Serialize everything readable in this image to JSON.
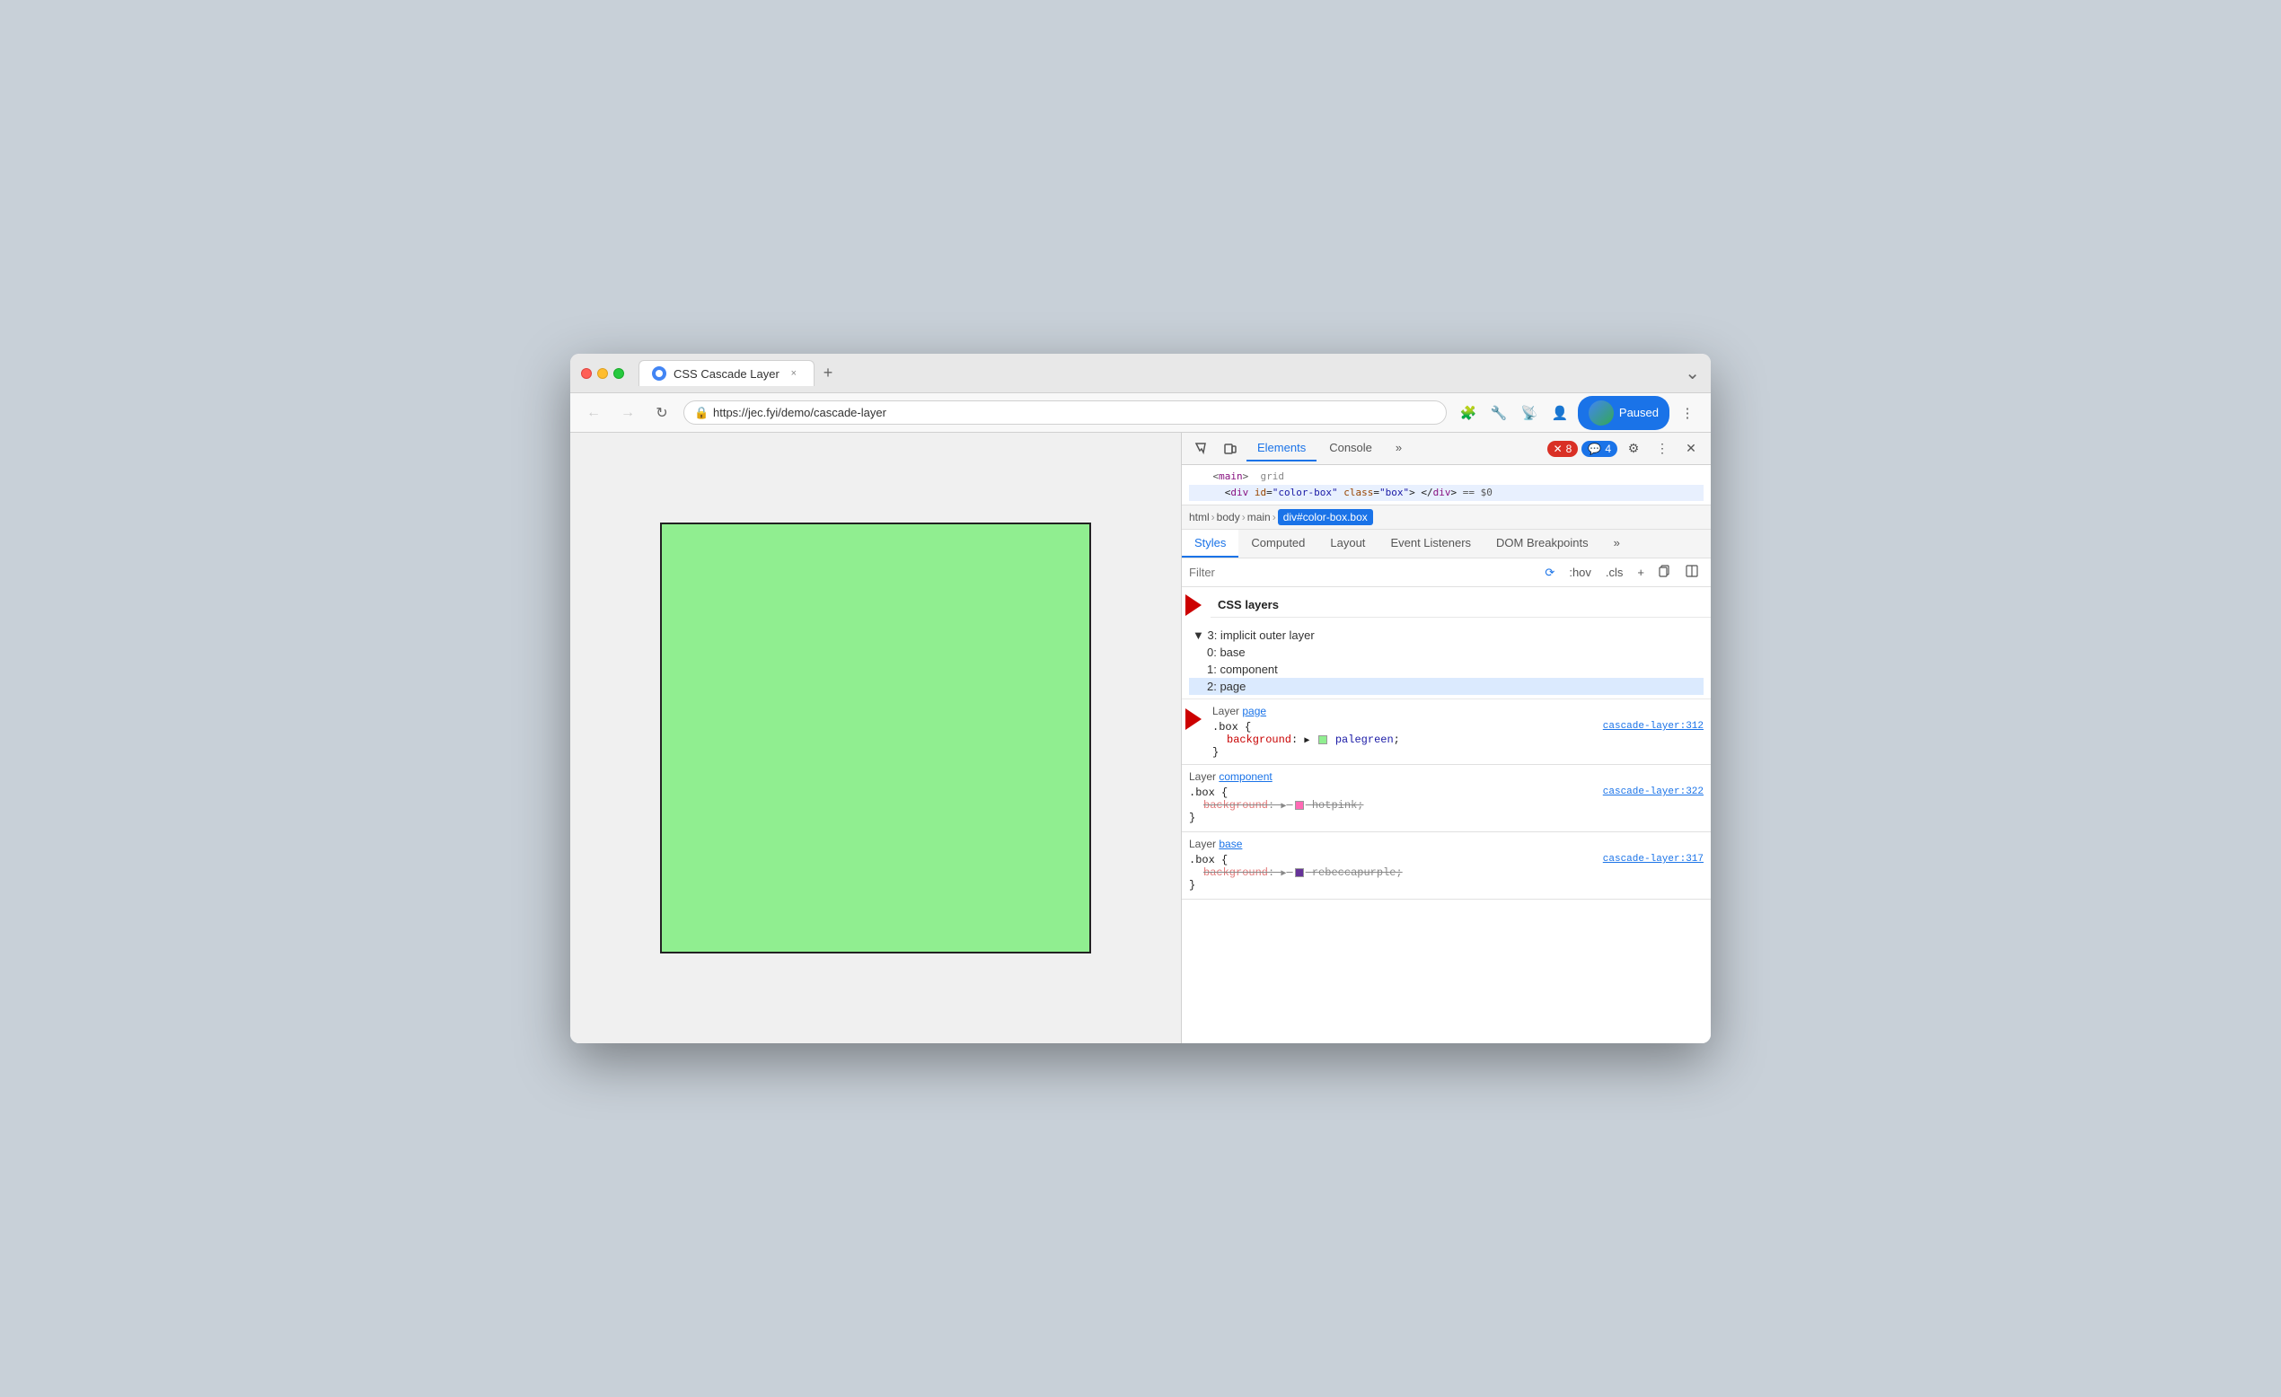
{
  "browser": {
    "title": "CSS Cascade Layer",
    "url": "https://jec.fyi/demo/cascade-layer",
    "tab_close": "×",
    "tab_new": "+",
    "nav": {
      "back": "←",
      "forward": "→",
      "refresh": "↻",
      "more": "⋮"
    },
    "paused_label": "Paused",
    "chevron_down": "⌄"
  },
  "devtools": {
    "tabs": [
      "Elements",
      "Console"
    ],
    "active_tab": "Elements",
    "more_tabs": "»",
    "errors": "8",
    "warnings": "4",
    "dom": {
      "line1": "main  grid",
      "line2": "<div id=\"color-box\" class=\"box\"> </div>  == $0"
    },
    "breadcrumb": [
      "html",
      "body",
      "main",
      "div#color-box.box"
    ],
    "style_tabs": [
      "Styles",
      "Computed",
      "Layout",
      "Event Listeners",
      "DOM Breakpoints"
    ],
    "active_style_tab": "Styles",
    "filter_placeholder": "Filter",
    "filter_icons": [
      ":hov",
      ".cls",
      "+",
      "📋",
      "◫"
    ],
    "css_layers_label": "CSS layers",
    "layers_tree": [
      {
        "label": "▼ 3: implicit outer layer",
        "indent": 0
      },
      {
        "label": "0: base",
        "indent": 1
      },
      {
        "label": "1: component",
        "indent": 1
      },
      {
        "label": "2: page",
        "indent": 1,
        "highlighted": true
      }
    ],
    "layer_sections": [
      {
        "header_prefix": "Layer ",
        "header_link": "page",
        "selector": ".box {",
        "property": "background",
        "value": "palegreen",
        "color": "#90ee90",
        "source": "cascade-layer:312",
        "strikethrough": false,
        "close": "}"
      },
      {
        "header_prefix": "Layer ",
        "header_link": "component",
        "selector": ".box {",
        "property": "background",
        "value": "hotpink",
        "color": "#ff69b4",
        "source": "cascade-layer:322",
        "strikethrough": true,
        "close": "}"
      },
      {
        "header_prefix": "Layer ",
        "header_link": "base",
        "selector": ".box {",
        "property": "background",
        "value": "rebeccapurple",
        "color": "#663399",
        "source": "cascade-layer:317",
        "strikethrough": true,
        "close": "}"
      }
    ],
    "arrows": [
      {
        "label": "CSS layers arrow",
        "points_to": "css-layers"
      },
      {
        "label": "Layer page arrow",
        "points_to": "layer-page"
      }
    ]
  }
}
